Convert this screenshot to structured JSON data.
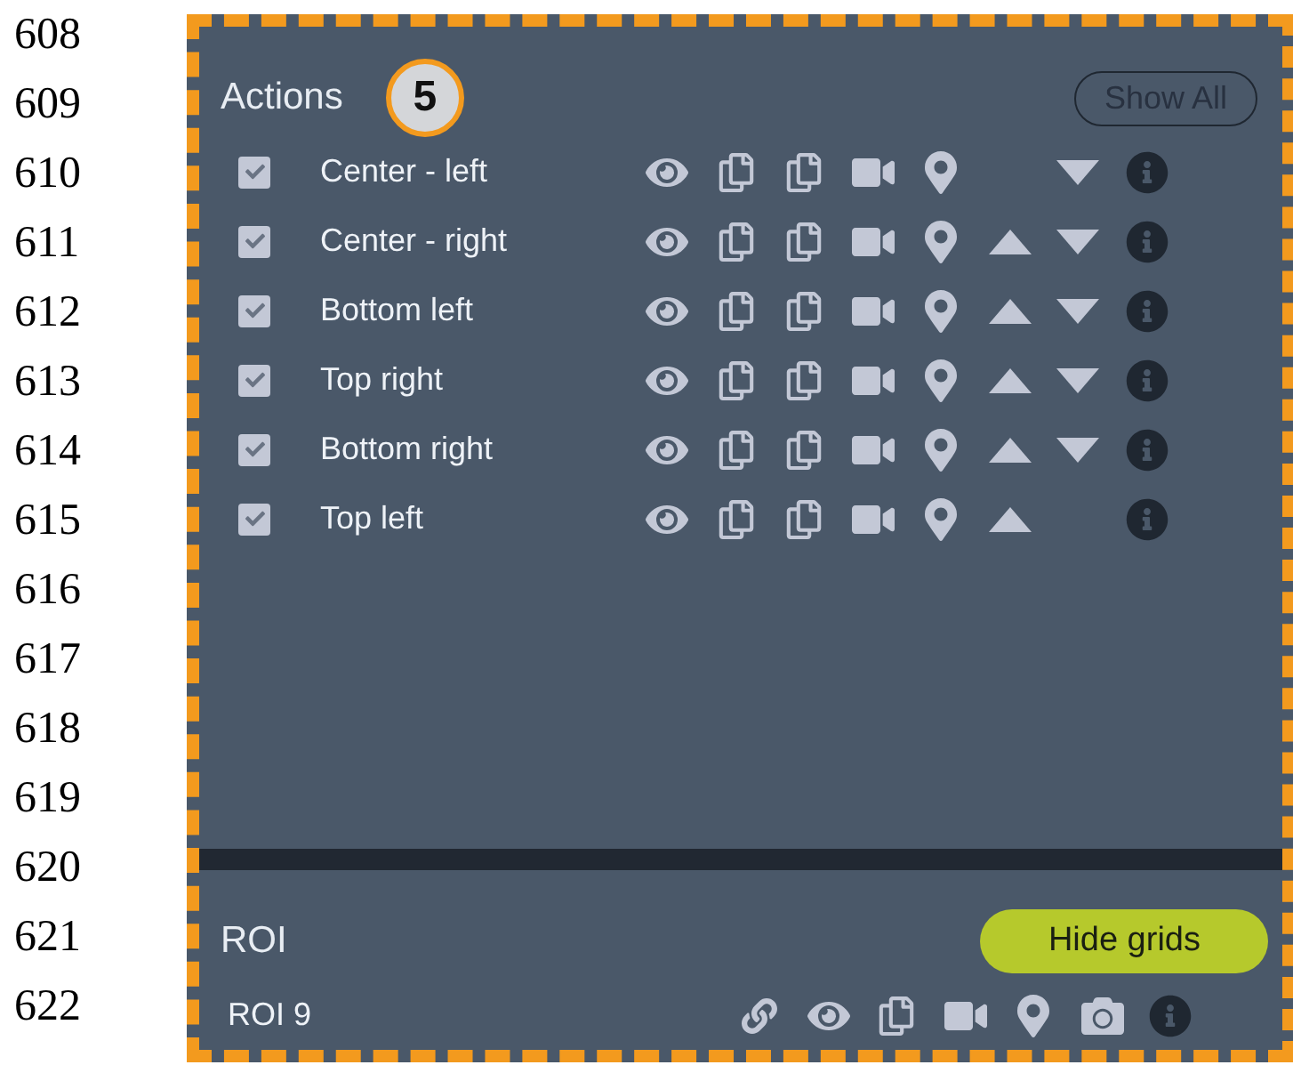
{
  "line_numbers": [
    "608",
    "609",
    "610",
    "611",
    "612",
    "613",
    "614",
    "615",
    "616",
    "617",
    "618",
    "619",
    "620",
    "621",
    "622"
  ],
  "actions": {
    "title": "Actions",
    "badge": "5",
    "show_all_button": "Show All",
    "rows": [
      {
        "label": "Center - left",
        "checked": true,
        "move_up": false,
        "move_down": true
      },
      {
        "label": "Center - right",
        "checked": true,
        "move_up": true,
        "move_down": true
      },
      {
        "label": "Bottom left",
        "checked": true,
        "move_up": true,
        "move_down": true
      },
      {
        "label": "Top right",
        "checked": true,
        "move_up": true,
        "move_down": true
      },
      {
        "label": "Bottom right",
        "checked": true,
        "move_up": true,
        "move_down": true
      },
      {
        "label": "Top left",
        "checked": true,
        "move_up": true,
        "move_down": false
      }
    ]
  },
  "roi": {
    "title": "ROI",
    "hide_grids_button": "Hide grids",
    "items": [
      {
        "label": "ROI 9"
      }
    ]
  }
}
